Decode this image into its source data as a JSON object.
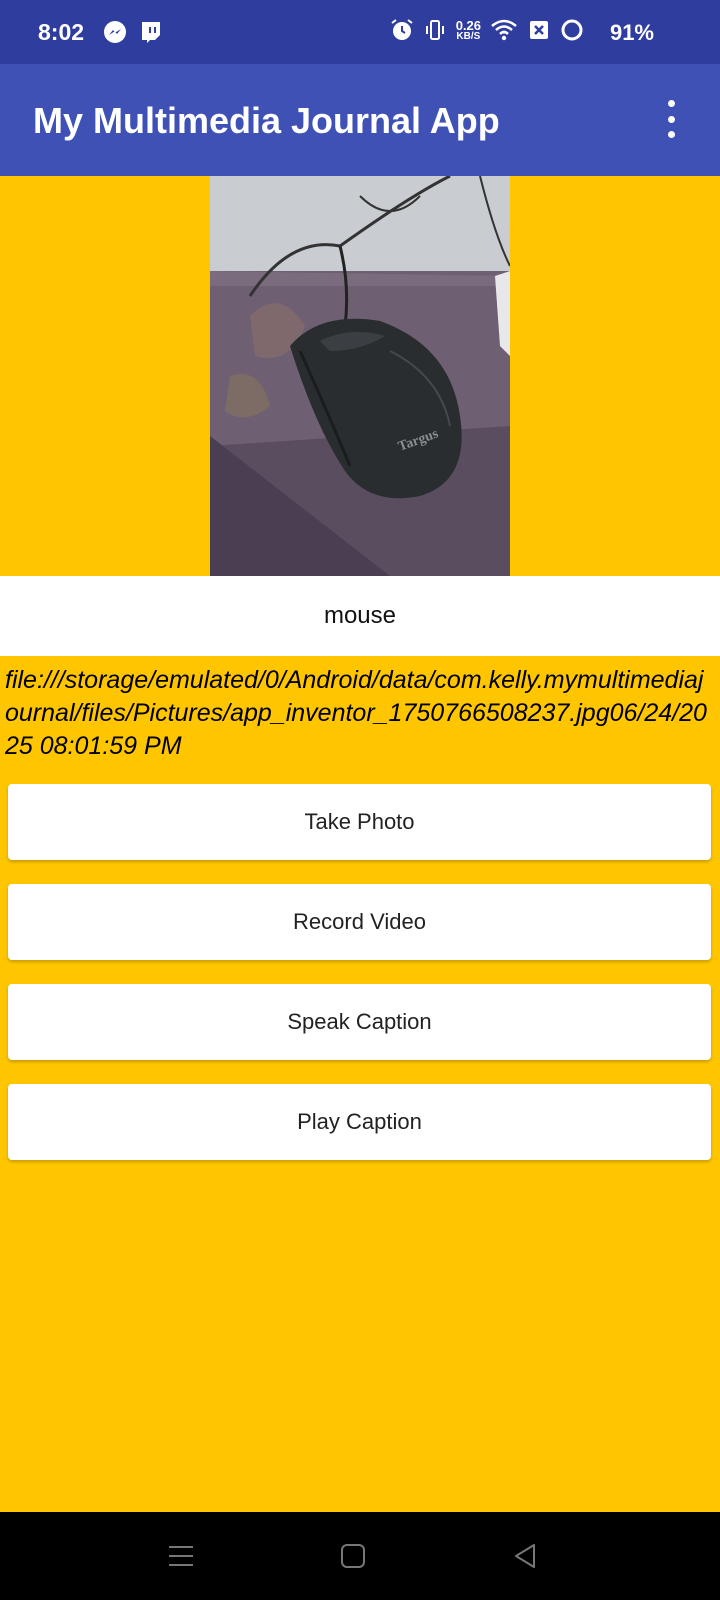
{
  "status_bar": {
    "time": "8:02",
    "net_speed_value": "0.26",
    "net_speed_unit": "KB/S",
    "battery": "91%"
  },
  "app_bar": {
    "title": "My Multimedia Journal App"
  },
  "photo": {
    "brand_text": "Targus"
  },
  "caption": {
    "text": "mouse"
  },
  "file_info": {
    "text": "file:///storage/emulated/0/Android/data/com.kelly.mymultimediajournal/files/Pictures/app_inventor_1750766508237.jpg06/24/2025 08:01:59 PM"
  },
  "buttons": {
    "take_photo": "Take Photo",
    "record_video": "Record Video",
    "speak_caption": "Speak Caption",
    "play_caption": "Play Caption"
  },
  "colors": {
    "status_bar": "#2F3E9E",
    "app_bar": "#3F51B5",
    "background": "#FFC600"
  },
  "icons": {
    "status_left": [
      "messenger-icon",
      "twitch-icon"
    ],
    "status_right": [
      "alarm-icon",
      "vibrate-icon",
      "wifi-icon",
      "sim-icon",
      "battery-icon"
    ],
    "app_bar": [
      "overflow-menu-icon"
    ],
    "nav": [
      "recents-icon",
      "home-icon",
      "back-icon"
    ]
  }
}
